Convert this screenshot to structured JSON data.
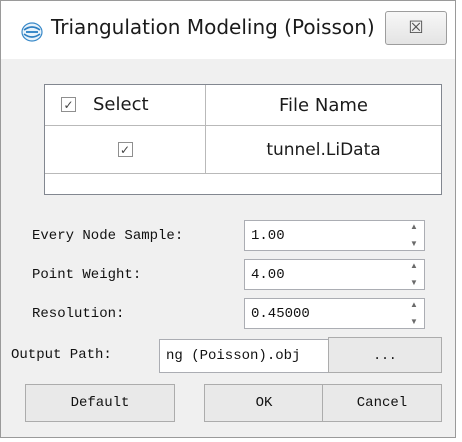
{
  "window": {
    "title": "Triangulation Modeling (Poisson)",
    "close_glyph": "☒"
  },
  "table": {
    "headers": {
      "select": "Select",
      "file_name": "File Name"
    },
    "rows": [
      {
        "checked": true,
        "file": "tunnel.LiData"
      }
    ]
  },
  "params": {
    "every_node_sample": {
      "label": "Every Node Sample:",
      "value": "1.00"
    },
    "point_weight": {
      "label": "Point Weight:",
      "value": "4.00"
    },
    "resolution": {
      "label": "Resolution:",
      "value": "0.45000"
    }
  },
  "output": {
    "label": "Output Path:",
    "value": "ng (Poisson).obj",
    "browse_label": "..."
  },
  "buttons": {
    "default": "Default",
    "ok": "OK",
    "cancel": "Cancel"
  },
  "icons": {
    "app": "app-logo-icon",
    "checkbox_checked": "✓"
  }
}
